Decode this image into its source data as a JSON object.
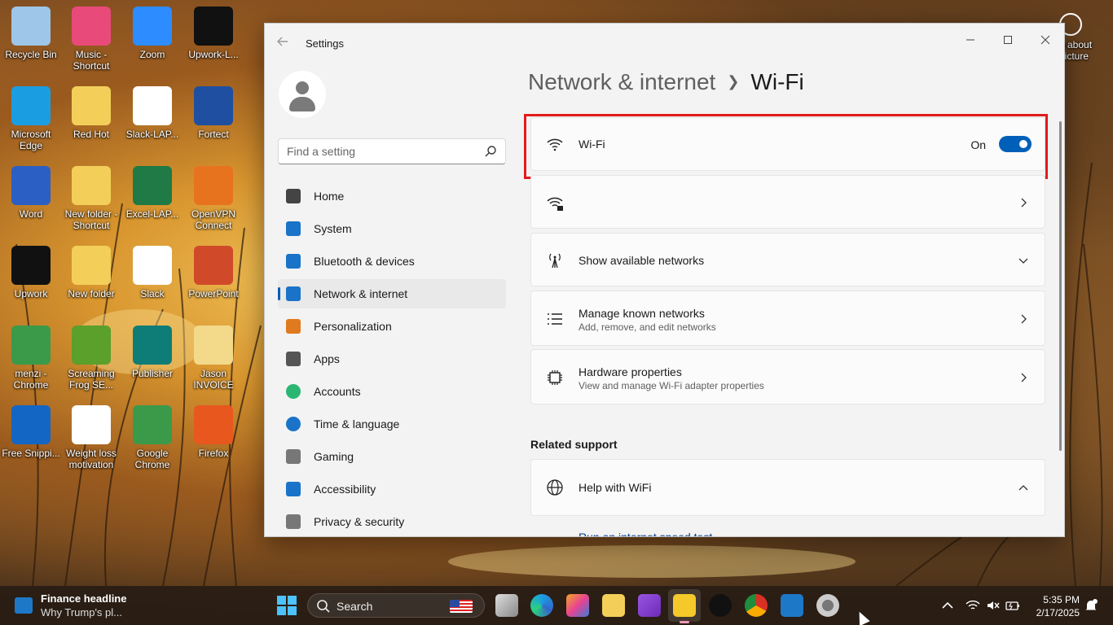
{
  "desktop": {
    "icons": [
      {
        "label": "Recycle Bin",
        "icon": "recycle-bin-icon",
        "color": "#9ec6e8"
      },
      {
        "label": "Music - Shortcut",
        "icon": "music-icon",
        "color": "#e84a7a"
      },
      {
        "label": "Zoom",
        "icon": "zoom-icon",
        "color": "#2d8cff"
      },
      {
        "label": "Upwork-L...",
        "icon": "upwork-icon",
        "color": "#111111"
      },
      {
        "label": "Microsoft Edge",
        "icon": "edge-icon",
        "color": "#1b9de2"
      },
      {
        "label": "Red Hot",
        "icon": "folder-icon",
        "color": "#f3cf5a"
      },
      {
        "label": "Slack-LAP...",
        "icon": "slack-icon",
        "color": "#ffffff"
      },
      {
        "label": "Fortect",
        "icon": "fortect-icon",
        "color": "#1f4fa0"
      },
      {
        "label": "Word",
        "icon": "word-icon",
        "color": "#2b5fc4"
      },
      {
        "label": "New folder - Shortcut",
        "icon": "folder-icon",
        "color": "#f3cf5a"
      },
      {
        "label": "Excel-LAP...",
        "icon": "excel-icon",
        "color": "#1f7a45"
      },
      {
        "label": "OpenVPN Connect",
        "icon": "openvpn-icon",
        "color": "#e8731e"
      },
      {
        "label": "Upwork",
        "icon": "upwork-icon",
        "color": "#111111"
      },
      {
        "label": "New folder",
        "icon": "folder-icon",
        "color": "#f3cf5a"
      },
      {
        "label": "Slack",
        "icon": "slack-icon",
        "color": "#ffffff"
      },
      {
        "label": "PowerPoint",
        "icon": "powerpoint-icon",
        "color": "#d04a2a"
      },
      {
        "label": "menzi - Chrome",
        "icon": "chrome-icon",
        "color": "#3a9a4a"
      },
      {
        "label": "Screaming Frog SE...",
        "icon": "frog-icon",
        "color": "#5aa02a"
      },
      {
        "label": "Publisher",
        "icon": "publisher-icon",
        "color": "#0f7d77"
      },
      {
        "label": "Jason INVOICE",
        "icon": "folder-icon",
        "color": "#f3d98a"
      },
      {
        "label": "Free Snippi...",
        "icon": "plus-icon",
        "color": "#1466c4"
      },
      {
        "label": "Weight loss motivation",
        "icon": "word-doc-icon",
        "color": "#ffffff"
      },
      {
        "label": "Google Chrome",
        "icon": "chrome-icon",
        "color": "#3a9a4a"
      },
      {
        "label": "Firefox",
        "icon": "firefox-icon",
        "color": "#e8571e"
      }
    ],
    "right_partial_label": "o about\npicture"
  },
  "window": {
    "title": "Settings",
    "search_placeholder": "Find a setting",
    "nav": [
      {
        "label": "Home",
        "icon": "home-icon",
        "active": false
      },
      {
        "label": "System",
        "icon": "system-icon",
        "active": false
      },
      {
        "label": "Bluetooth & devices",
        "icon": "bluetooth-icon",
        "active": false
      },
      {
        "label": "Network & internet",
        "icon": "wifi-icon",
        "active": true
      },
      {
        "label": "Personalization",
        "icon": "brush-icon",
        "active": false
      },
      {
        "label": "Apps",
        "icon": "apps-icon",
        "active": false
      },
      {
        "label": "Accounts",
        "icon": "accounts-icon",
        "active": false
      },
      {
        "label": "Time & language",
        "icon": "clock-icon",
        "active": false
      },
      {
        "label": "Gaming",
        "icon": "gaming-icon",
        "active": false
      },
      {
        "label": "Accessibility",
        "icon": "accessibility-icon",
        "active": false
      },
      {
        "label": "Privacy & security",
        "icon": "shield-icon",
        "active": false
      }
    ],
    "breadcrumb": {
      "parent": "Network & internet",
      "current": "Wi-Fi"
    },
    "wifi_toggle": {
      "label": "Wi-Fi",
      "state_label": "On",
      "on": true
    },
    "connected_network": {
      "label": ""
    },
    "cards": [
      {
        "title": "Show available networks",
        "subtitle": "",
        "icon": "antenna-icon",
        "chevron": "down"
      },
      {
        "title": "Manage known networks",
        "subtitle": "Add, remove, and edit networks",
        "icon": "list-icon",
        "chevron": "right"
      },
      {
        "title": "Hardware properties",
        "subtitle": "View and manage Wi-Fi adapter properties",
        "icon": "chip-icon",
        "chevron": "right"
      }
    ],
    "related_support": {
      "title": "Related support",
      "help_title": "Help with WiFi",
      "link": "Run an internet speed test"
    }
  },
  "taskbar": {
    "news_title": "Finance headline",
    "news_text": "Why Trump's pl...",
    "search_label": "Search",
    "clock_time": "5:35 PM",
    "clock_date": "2/17/2025"
  },
  "colors": {
    "accent": "#005fb8",
    "highlight": "#e21b1b"
  }
}
